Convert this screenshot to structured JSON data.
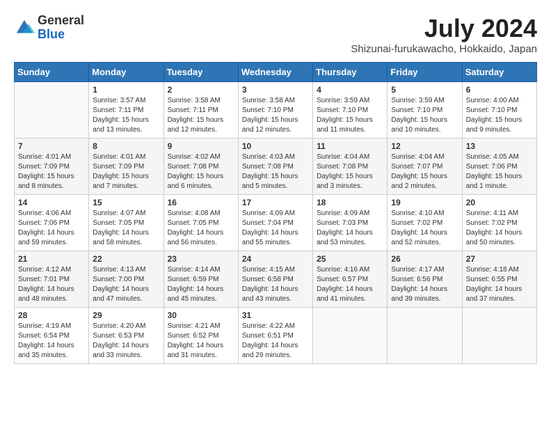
{
  "header": {
    "logo_general": "General",
    "logo_blue": "Blue",
    "month_title": "July 2024",
    "location": "Shizunai-furukawacho, Hokkaido, Japan"
  },
  "weekdays": [
    "Sunday",
    "Monday",
    "Tuesday",
    "Wednesday",
    "Thursday",
    "Friday",
    "Saturday"
  ],
  "weeks": [
    [
      {
        "day": "",
        "info": ""
      },
      {
        "day": "1",
        "info": "Sunrise: 3:57 AM\nSunset: 7:11 PM\nDaylight: 15 hours\nand 13 minutes."
      },
      {
        "day": "2",
        "info": "Sunrise: 3:58 AM\nSunset: 7:11 PM\nDaylight: 15 hours\nand 12 minutes."
      },
      {
        "day": "3",
        "info": "Sunrise: 3:58 AM\nSunset: 7:10 PM\nDaylight: 15 hours\nand 12 minutes."
      },
      {
        "day": "4",
        "info": "Sunrise: 3:59 AM\nSunset: 7:10 PM\nDaylight: 15 hours\nand 11 minutes."
      },
      {
        "day": "5",
        "info": "Sunrise: 3:59 AM\nSunset: 7:10 PM\nDaylight: 15 hours\nand 10 minutes."
      },
      {
        "day": "6",
        "info": "Sunrise: 4:00 AM\nSunset: 7:10 PM\nDaylight: 15 hours\nand 9 minutes."
      }
    ],
    [
      {
        "day": "7",
        "info": "Sunrise: 4:01 AM\nSunset: 7:09 PM\nDaylight: 15 hours\nand 8 minutes."
      },
      {
        "day": "8",
        "info": "Sunrise: 4:01 AM\nSunset: 7:09 PM\nDaylight: 15 hours\nand 7 minutes."
      },
      {
        "day": "9",
        "info": "Sunrise: 4:02 AM\nSunset: 7:08 PM\nDaylight: 15 hours\nand 6 minutes."
      },
      {
        "day": "10",
        "info": "Sunrise: 4:03 AM\nSunset: 7:08 PM\nDaylight: 15 hours\nand 5 minutes."
      },
      {
        "day": "11",
        "info": "Sunrise: 4:04 AM\nSunset: 7:08 PM\nDaylight: 15 hours\nand 3 minutes."
      },
      {
        "day": "12",
        "info": "Sunrise: 4:04 AM\nSunset: 7:07 PM\nDaylight: 15 hours\nand 2 minutes."
      },
      {
        "day": "13",
        "info": "Sunrise: 4:05 AM\nSunset: 7:06 PM\nDaylight: 15 hours\nand 1 minute."
      }
    ],
    [
      {
        "day": "14",
        "info": "Sunrise: 4:06 AM\nSunset: 7:06 PM\nDaylight: 14 hours\nand 59 minutes."
      },
      {
        "day": "15",
        "info": "Sunrise: 4:07 AM\nSunset: 7:05 PM\nDaylight: 14 hours\nand 58 minutes."
      },
      {
        "day": "16",
        "info": "Sunrise: 4:08 AM\nSunset: 7:05 PM\nDaylight: 14 hours\nand 56 minutes."
      },
      {
        "day": "17",
        "info": "Sunrise: 4:09 AM\nSunset: 7:04 PM\nDaylight: 14 hours\nand 55 minutes."
      },
      {
        "day": "18",
        "info": "Sunrise: 4:09 AM\nSunset: 7:03 PM\nDaylight: 14 hours\nand 53 minutes."
      },
      {
        "day": "19",
        "info": "Sunrise: 4:10 AM\nSunset: 7:02 PM\nDaylight: 14 hours\nand 52 minutes."
      },
      {
        "day": "20",
        "info": "Sunrise: 4:11 AM\nSunset: 7:02 PM\nDaylight: 14 hours\nand 50 minutes."
      }
    ],
    [
      {
        "day": "21",
        "info": "Sunrise: 4:12 AM\nSunset: 7:01 PM\nDaylight: 14 hours\nand 48 minutes."
      },
      {
        "day": "22",
        "info": "Sunrise: 4:13 AM\nSunset: 7:00 PM\nDaylight: 14 hours\nand 47 minutes."
      },
      {
        "day": "23",
        "info": "Sunrise: 4:14 AM\nSunset: 6:59 PM\nDaylight: 14 hours\nand 45 minutes."
      },
      {
        "day": "24",
        "info": "Sunrise: 4:15 AM\nSunset: 6:58 PM\nDaylight: 14 hours\nand 43 minutes."
      },
      {
        "day": "25",
        "info": "Sunrise: 4:16 AM\nSunset: 6:57 PM\nDaylight: 14 hours\nand 41 minutes."
      },
      {
        "day": "26",
        "info": "Sunrise: 4:17 AM\nSunset: 6:56 PM\nDaylight: 14 hours\nand 39 minutes."
      },
      {
        "day": "27",
        "info": "Sunrise: 4:18 AM\nSunset: 6:55 PM\nDaylight: 14 hours\nand 37 minutes."
      }
    ],
    [
      {
        "day": "28",
        "info": "Sunrise: 4:19 AM\nSunset: 6:54 PM\nDaylight: 14 hours\nand 35 minutes."
      },
      {
        "day": "29",
        "info": "Sunrise: 4:20 AM\nSunset: 6:53 PM\nDaylight: 14 hours\nand 33 minutes."
      },
      {
        "day": "30",
        "info": "Sunrise: 4:21 AM\nSunset: 6:52 PM\nDaylight: 14 hours\nand 31 minutes."
      },
      {
        "day": "31",
        "info": "Sunrise: 4:22 AM\nSunset: 6:51 PM\nDaylight: 14 hours\nand 29 minutes."
      },
      {
        "day": "",
        "info": ""
      },
      {
        "day": "",
        "info": ""
      },
      {
        "day": "",
        "info": ""
      }
    ]
  ]
}
